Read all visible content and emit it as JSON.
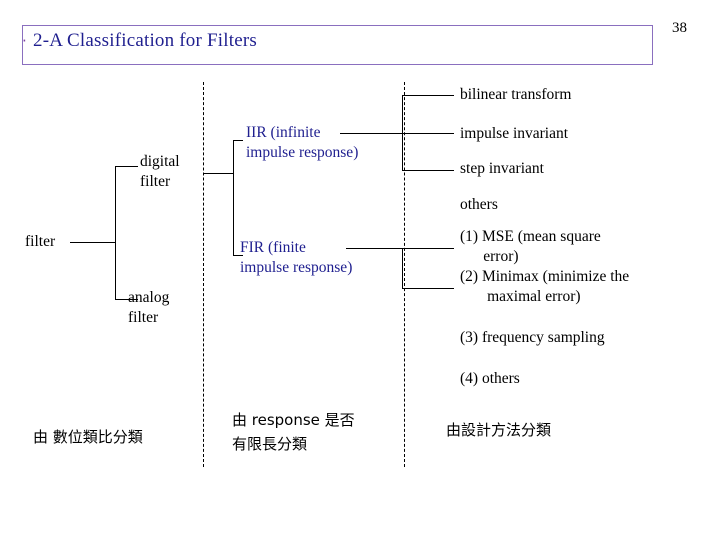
{
  "slide": {
    "page_number": "38",
    "bullet": "‧",
    "title": "2-A  Classification for Filters",
    "tree": {
      "root_label": "filter",
      "branch_digital": "digital\nfilter",
      "branch_analog": "analog\nfilter",
      "iir_label": "IIR (infinite\nimpulse response)",
      "fir_label": "FIR (finite\nimpulse response)",
      "right_items": [
        "bilinear transform",
        "impulse invariant",
        "step invariant",
        "others",
        "(1) MSE (mean square\n      error)\n(2) Minimax (minimize the\n       maximal error)",
        "(3) frequency sampling",
        "(4) others"
      ]
    },
    "captions": {
      "col1": "由 數位類比分類",
      "col2": "由 response 是否\n有限長分類",
      "col3": "由設計方法分類"
    }
  }
}
